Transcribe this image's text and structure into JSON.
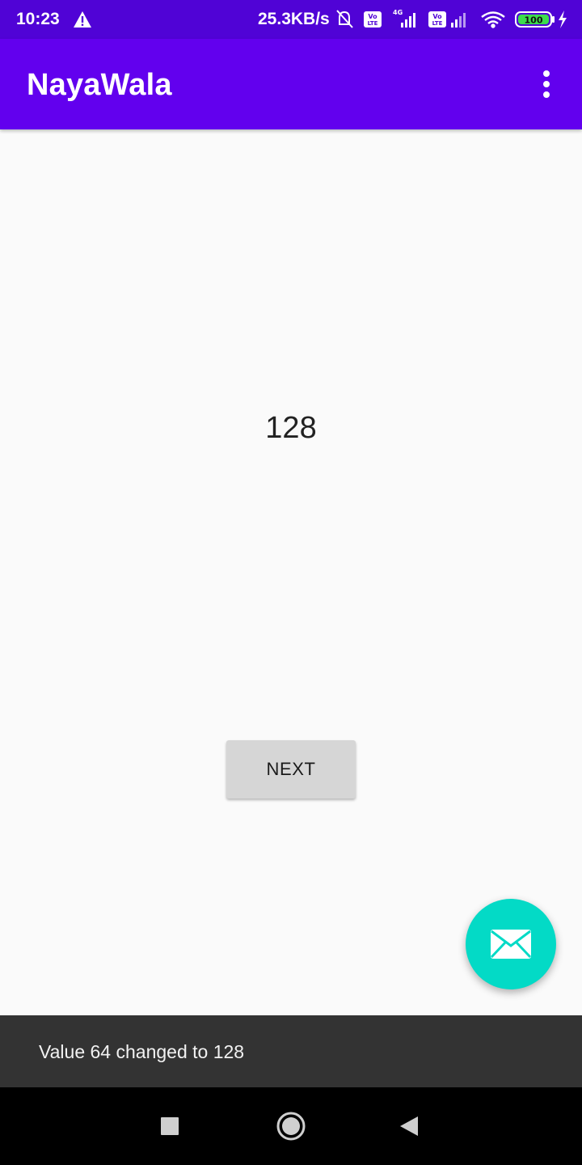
{
  "status_bar": {
    "time": "10:23",
    "net_speed": "25.3KB/s",
    "battery": "100",
    "volte_label_1": "Vo",
    "volte_label_2": "LTE",
    "network_type": "4G"
  },
  "app_bar": {
    "title": "NayaWala"
  },
  "content": {
    "value": "128",
    "next_label": "NEXT"
  },
  "snackbar": {
    "message": "Value 64 changed to 128"
  },
  "colors": {
    "status_bar": "#5003d6",
    "app_bar": "#6200ee",
    "fab": "#03dac6",
    "snackbar": "#333333"
  },
  "icons": {
    "alert": "warning-triangle-icon",
    "overflow": "more-vert-icon",
    "fab": "mail-icon",
    "nav_recents": "square-icon",
    "nav_home": "circle-icon",
    "nav_back": "triangle-back-icon"
  }
}
